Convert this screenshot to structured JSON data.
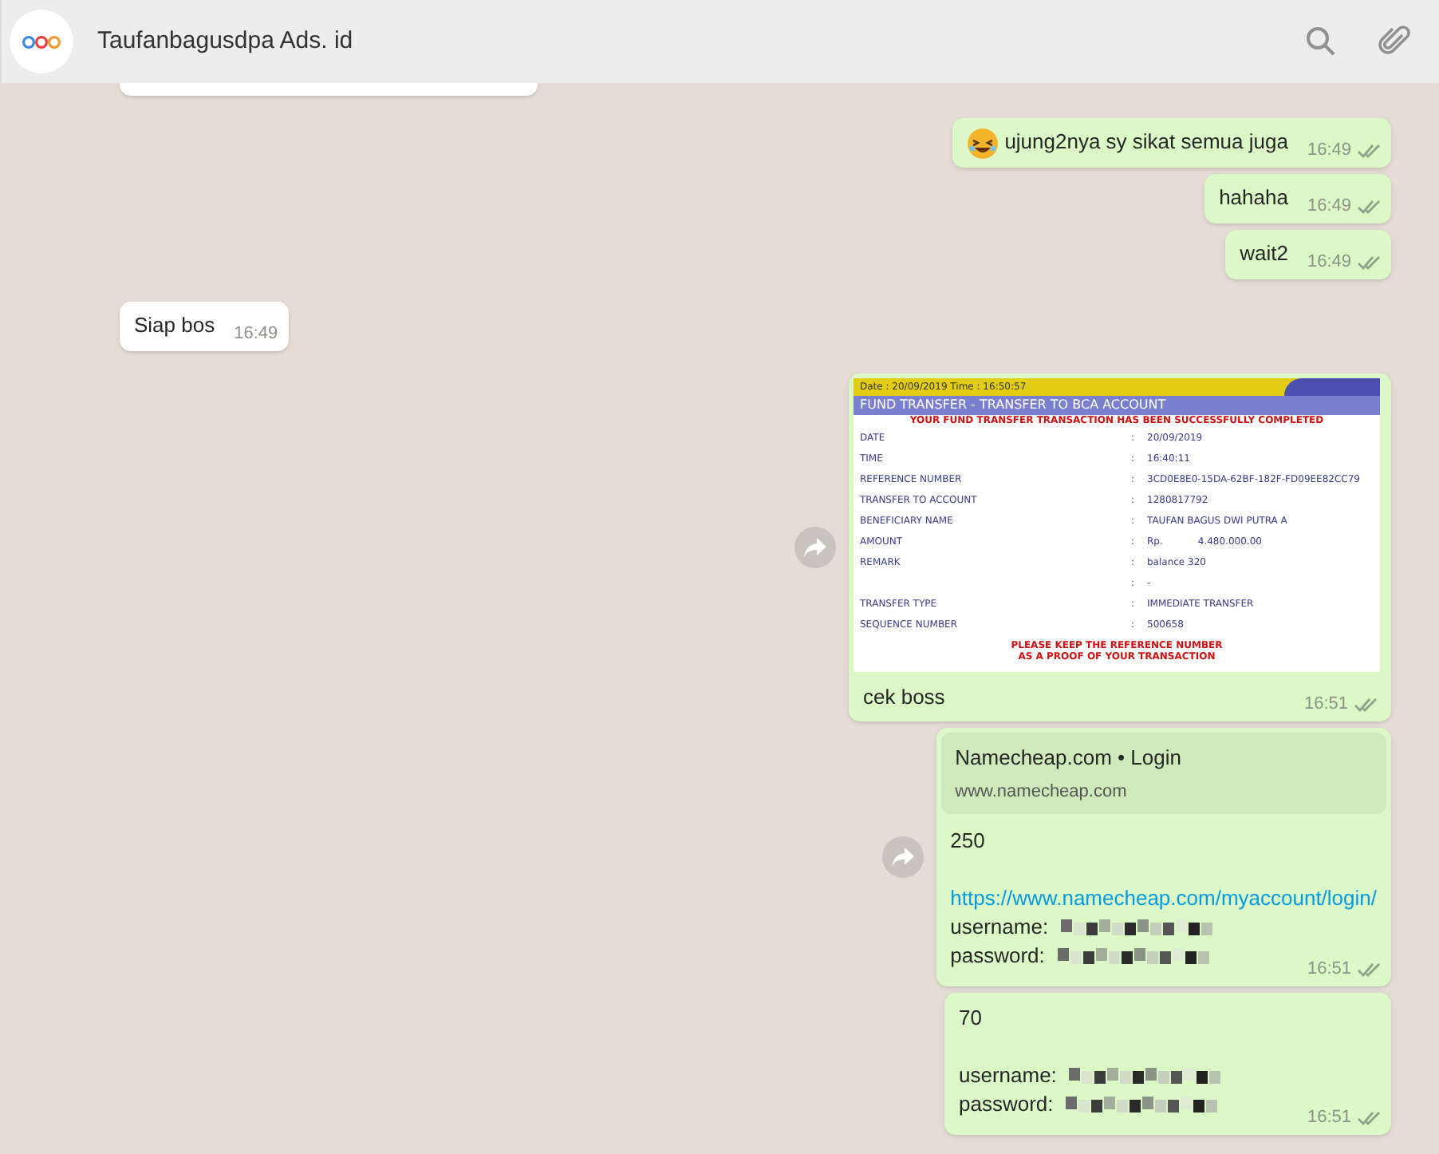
{
  "header": {
    "title": "Taufanbagusdpa Ads. id"
  },
  "messages": [
    {
      "kind": "text",
      "outgoing": true,
      "emoji": true,
      "text": "ujung2nya sy sikat semua juga",
      "time": "16:49",
      "read": false
    },
    {
      "kind": "text",
      "outgoing": true,
      "emoji": false,
      "text": "hahaha",
      "time": "16:49",
      "read": false
    },
    {
      "kind": "text",
      "outgoing": true,
      "emoji": false,
      "text": "wait2",
      "time": "16:49",
      "read": false
    },
    {
      "kind": "text",
      "outgoing": false,
      "emoji": false,
      "text": "Siap bos",
      "time": "16:49"
    },
    {
      "kind": "receipt",
      "outgoing": true,
      "forward_button": true,
      "caption": "cek boss",
      "time": "16:51",
      "read": false,
      "receipt": {
        "date_line": "Date : 20/09/2019 Time : 16:50:57",
        "title": "FUND TRANSFER - TRANSFER TO BCA ACCOUNT",
        "status": "YOUR FUND TRANSFER TRANSACTION HAS BEEN SUCCESSFULLY COMPLETED",
        "rows": [
          {
            "label": "DATE",
            "sep": ":",
            "value": "20/09/2019"
          },
          {
            "label": "TIME",
            "sep": ":",
            "value": "16:40:11"
          },
          {
            "label": "REFERENCE NUMBER",
            "sep": ":",
            "value": "3CD0E8E0-15DA-62BF-182F-FD09EE82CC79"
          },
          {
            "label": "TRANSFER TO ACCOUNT",
            "sep": ":",
            "value": "1280817792"
          },
          {
            "label": "BENEFICIARY NAME",
            "sep": ":",
            "value": "TAUFAN BAGUS DWI PUTRA A"
          },
          {
            "label": "AMOUNT",
            "sep": ":",
            "currency": "Rp.",
            "value": "4.480.000.00"
          },
          {
            "label": "REMARK",
            "sep": ":",
            "value": "balance 320"
          },
          {
            "sep": ":",
            "value": "-"
          },
          {
            "label": "TRANSFER TYPE",
            "sep": ":",
            "value": "IMMEDIATE TRANSFER"
          },
          {
            "label": "SEQUENCE NUMBER",
            "sep": ":",
            "value": "500658"
          }
        ],
        "footer": [
          "PLEASE KEEP THE REFERENCE NUMBER",
          "AS A PROOF OF YOUR TRANSACTION"
        ]
      }
    },
    {
      "kind": "lines",
      "outgoing": true,
      "forward_button": true,
      "preview": {
        "title": "Namecheap.com • Login",
        "domain": "www.namecheap.com"
      },
      "time": "16:51",
      "read": false,
      "lines": [
        {
          "kind": "text",
          "text": "250"
        },
        {
          "kind": "gap"
        },
        {
          "kind": "link",
          "text": "https://www.namecheap.com/myaccount/login/"
        },
        {
          "kind": "redacted",
          "text": "username:"
        },
        {
          "kind": "redacted",
          "text": "password:"
        }
      ]
    },
    {
      "kind": "lines",
      "outgoing": true,
      "forward_button": false,
      "time": "16:51",
      "read": false,
      "lines": [
        {
          "kind": "text",
          "text": "70"
        },
        {
          "kind": "gap"
        },
        {
          "kind": "redacted",
          "text": "username:"
        },
        {
          "kind": "redacted",
          "text": "password:"
        }
      ]
    }
  ]
}
